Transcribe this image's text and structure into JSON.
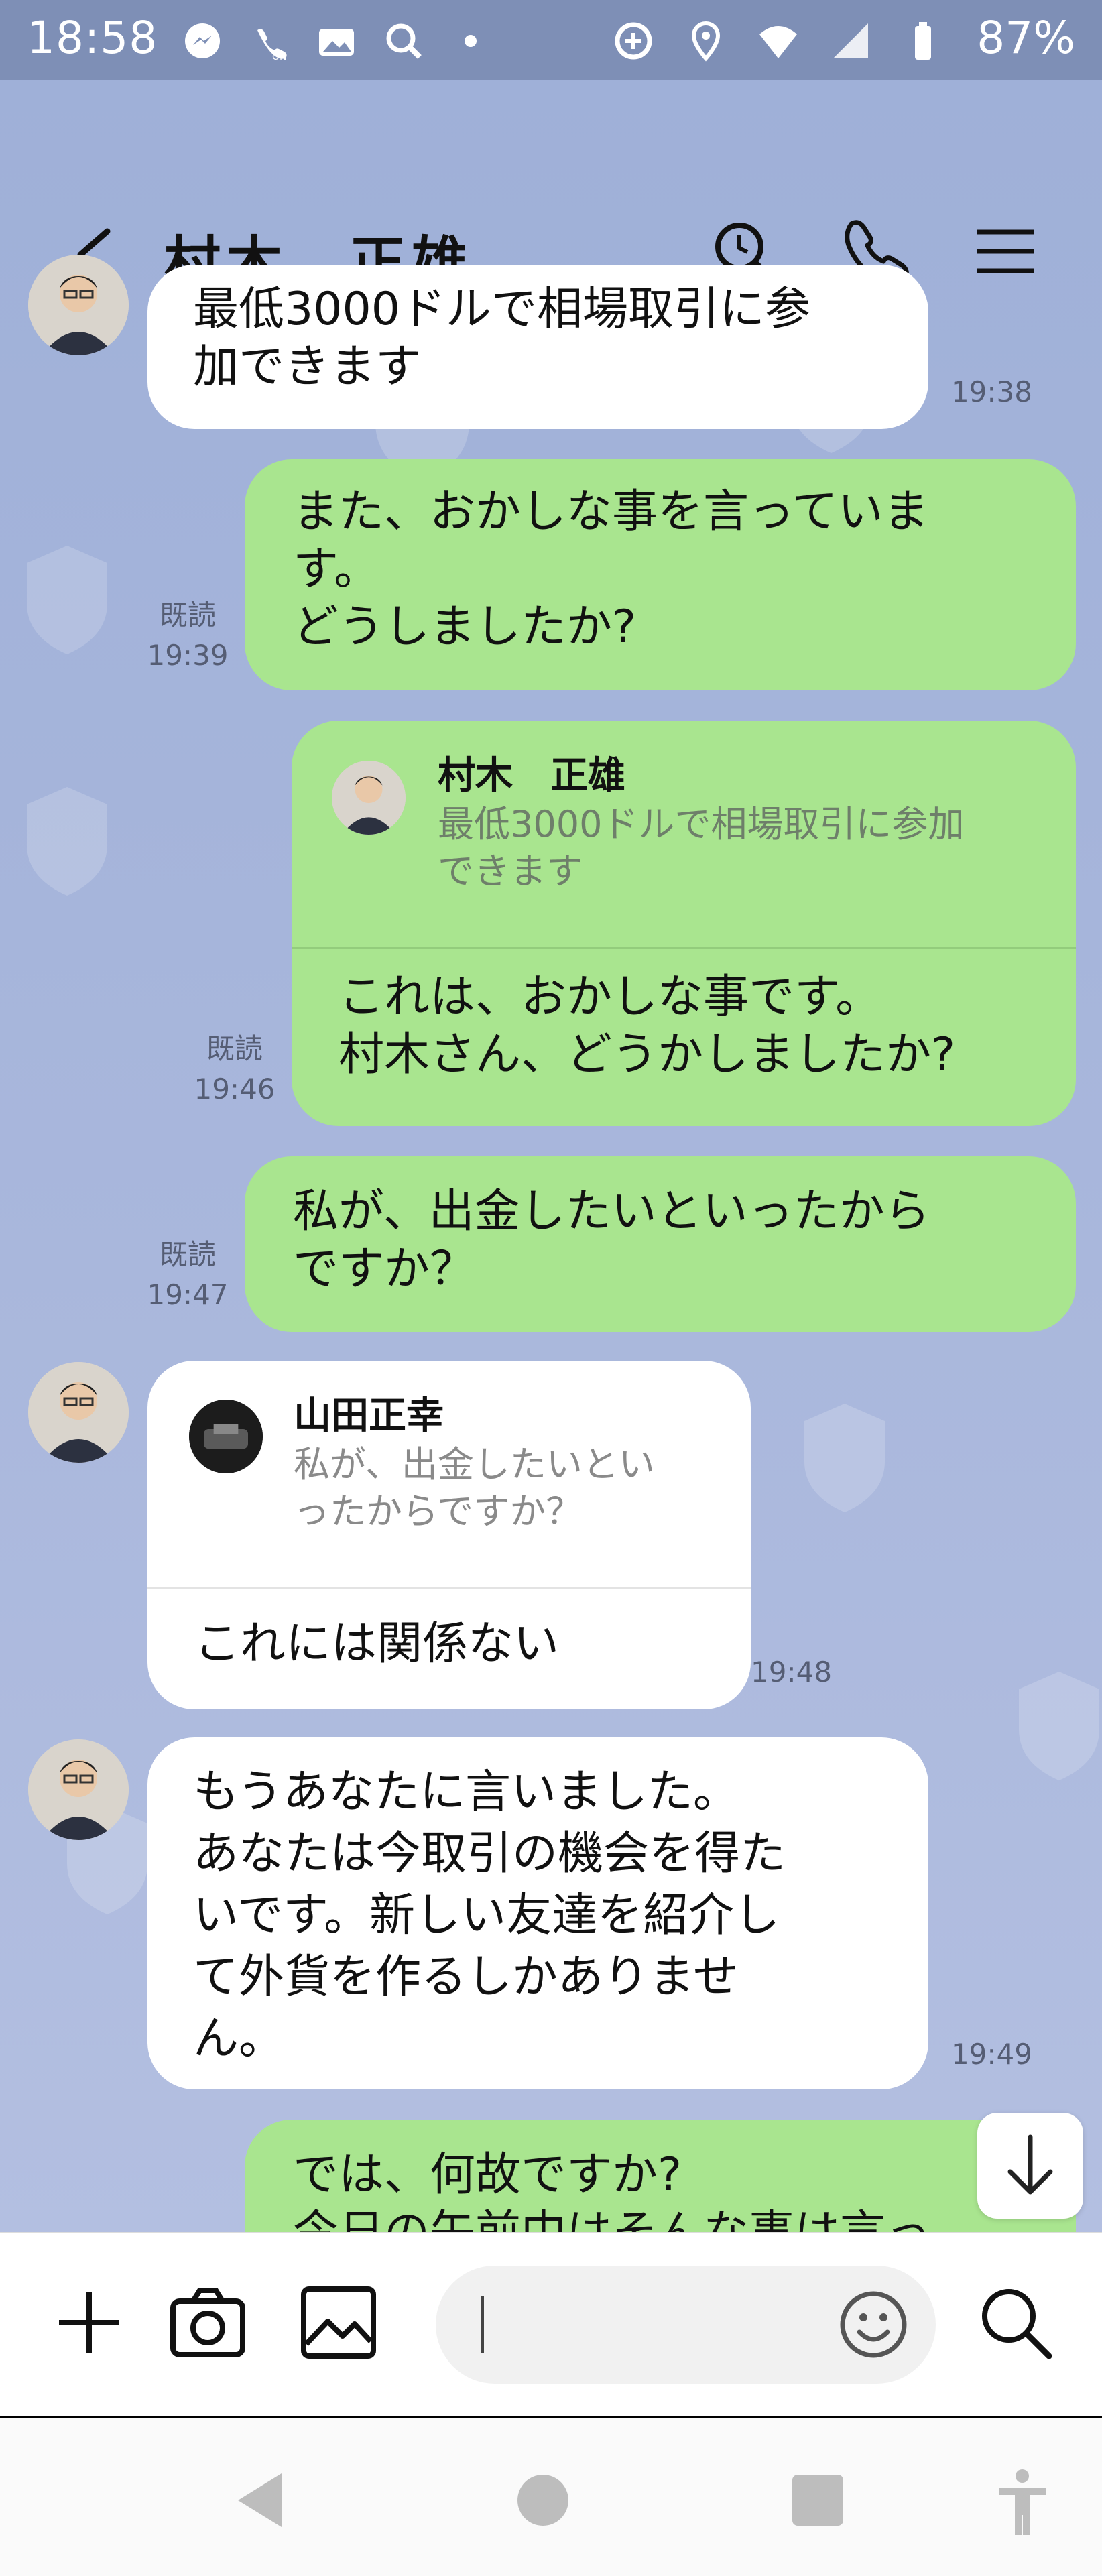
{
  "status_bar": {
    "time": "18:58",
    "battery": "87%",
    "icons": [
      "messenger-icon",
      "wifi-calling-icon",
      "gallery-icon",
      "vpn-search-icon",
      "dot-icon",
      "data-saver-icon",
      "location-icon",
      "wifi-icon",
      "signal-icon",
      "battery-icon"
    ]
  },
  "header": {
    "title": "村木　正雄",
    "icons": [
      "back-icon",
      "search-icon",
      "phone-icon",
      "menu-icon"
    ]
  },
  "messages": [
    {
      "side": "left",
      "text": "最低3000ドルで相場取引に参\n加できます",
      "time": "19:38"
    },
    {
      "side": "right",
      "text": "また、おかしな事を言っていま\nす。\nどうしましたか?",
      "read": "既読",
      "time": "19:39"
    },
    {
      "side": "right",
      "quote_name": "村木　正雄",
      "quote_text": "最低3000ドルで相場取引に参加\nできます",
      "text": "これは、おかしな事です。\n村木さん、どうかしましたか?",
      "read": "既読",
      "time": "19:46"
    },
    {
      "side": "right",
      "text": "私が、出金したいといったから\nですか？",
      "read": "既読",
      "time": "19:47"
    },
    {
      "side": "left",
      "quote_name": "山田正幸",
      "quote_text": "私が、出金したいとい\nったからですか？",
      "text": "これには関係ない",
      "time": "19:48"
    },
    {
      "side": "left",
      "text": "もうあなたに言いました。\nあなたは今取引の機会を得た\nいです。新しい友達を紹介し\nて外貨を作るしかありませ\nん。",
      "time": "19:49"
    },
    {
      "side": "right",
      "text": "では、何故ですか?\n今日の午前中はそんな事は言っ"
    }
  ],
  "input": {
    "placeholder": ""
  },
  "colors": {
    "green_bubble": "#a9e58f",
    "white_bubble": "#ffffff",
    "chat_bg": "#9fb0d8"
  }
}
